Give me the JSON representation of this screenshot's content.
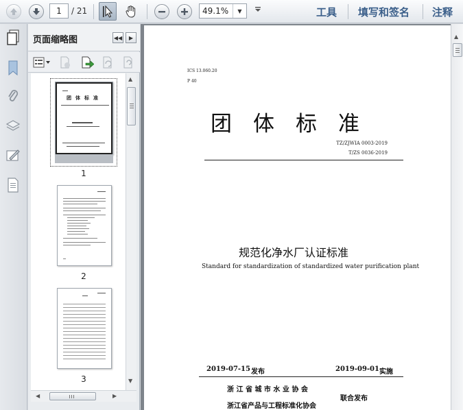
{
  "toolbar": {
    "page_current": "1",
    "page_total": "/ 21",
    "zoom": "49.1%",
    "tools_label": "工具",
    "sign_label": "填写和签名",
    "comment_label": "注释"
  },
  "thumbnails": {
    "title": "页面缩略图",
    "pages": [
      "1",
      "2",
      "3"
    ]
  },
  "document": {
    "ics": "ICS 13.060.20",
    "class_code": "P 40",
    "main_title": "团　体　标　准",
    "std_no_1": "TZ/ZJWIA  0003-2019",
    "std_no_2": "T/ZS 0036-2019",
    "cn_title": "规范化净水厂认证标准",
    "en_title": "Standard for standardization of standardized water purification plant",
    "publish_date": "2019-07-15",
    "publish_label": "发布",
    "impl_date": "2019-09-01",
    "impl_label": "实施",
    "org_1": "浙 江 省 城 市 水 业 协 会",
    "org_2": "浙江省产品与工程标准化协会",
    "joint_label": "联合发布"
  }
}
